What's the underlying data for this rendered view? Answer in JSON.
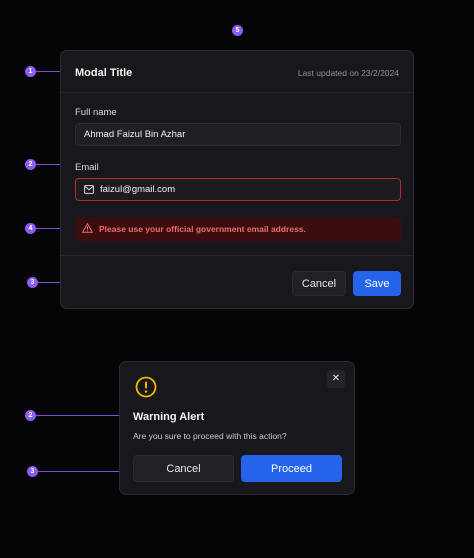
{
  "markers": [
    "1",
    "2",
    "3",
    "4",
    "5",
    "2",
    "3"
  ],
  "modal": {
    "title": "Modal Title",
    "updated": "Last updated on 23/2/2024",
    "full_name_label": "Full name",
    "full_name_value": "Ahmad Faizul Bin Azhar",
    "email_label": "Email",
    "email_value": "faizul@gmail.com",
    "error_message": "Please use your official government email address.",
    "cancel_label": "Cancel",
    "save_label": "Save"
  },
  "alert_modal": {
    "title": "Warning Alert",
    "message": "Are you sure to proceed with this action?",
    "close_glyph": "✕",
    "cancel_label": "Cancel",
    "proceed_label": "Proceed"
  },
  "colors": {
    "accent": "#2563eb",
    "marker": "#8b5cf6",
    "error": "#ef6a6a",
    "warning": "#f5b400"
  }
}
